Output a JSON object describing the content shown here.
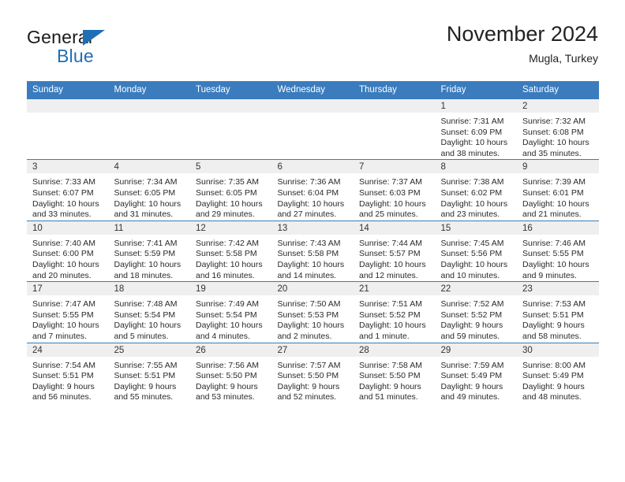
{
  "brand": {
    "name_part1": "General",
    "name_part2": "Blue",
    "logo_icon": "triangle-logo-icon",
    "accent_color": "#1f6fb5"
  },
  "header": {
    "title": "November 2024",
    "location": "Mugla, Turkey"
  },
  "theme": {
    "header_bar_color": "#3a7cbe",
    "daynum_strip_color": "#efefef",
    "row_border_color": "#3a7cbe",
    "text_color": "#2a2a2a"
  },
  "weekdays": [
    "Sunday",
    "Monday",
    "Tuesday",
    "Wednesday",
    "Thursday",
    "Friday",
    "Saturday"
  ],
  "weeks": [
    [
      {
        "day": "",
        "empty": true
      },
      {
        "day": "",
        "empty": true
      },
      {
        "day": "",
        "empty": true
      },
      {
        "day": "",
        "empty": true
      },
      {
        "day": "",
        "empty": true
      },
      {
        "day": "1",
        "sunrise": "Sunrise: 7:31 AM",
        "sunset": "Sunset: 6:09 PM",
        "daylight": "Daylight: 10 hours and 38 minutes."
      },
      {
        "day": "2",
        "sunrise": "Sunrise: 7:32 AM",
        "sunset": "Sunset: 6:08 PM",
        "daylight": "Daylight: 10 hours and 35 minutes."
      }
    ],
    [
      {
        "day": "3",
        "sunrise": "Sunrise: 7:33 AM",
        "sunset": "Sunset: 6:07 PM",
        "daylight": "Daylight: 10 hours and 33 minutes."
      },
      {
        "day": "4",
        "sunrise": "Sunrise: 7:34 AM",
        "sunset": "Sunset: 6:05 PM",
        "daylight": "Daylight: 10 hours and 31 minutes."
      },
      {
        "day": "5",
        "sunrise": "Sunrise: 7:35 AM",
        "sunset": "Sunset: 6:05 PM",
        "daylight": "Daylight: 10 hours and 29 minutes."
      },
      {
        "day": "6",
        "sunrise": "Sunrise: 7:36 AM",
        "sunset": "Sunset: 6:04 PM",
        "daylight": "Daylight: 10 hours and 27 minutes."
      },
      {
        "day": "7",
        "sunrise": "Sunrise: 7:37 AM",
        "sunset": "Sunset: 6:03 PM",
        "daylight": "Daylight: 10 hours and 25 minutes."
      },
      {
        "day": "8",
        "sunrise": "Sunrise: 7:38 AM",
        "sunset": "Sunset: 6:02 PM",
        "daylight": "Daylight: 10 hours and 23 minutes."
      },
      {
        "day": "9",
        "sunrise": "Sunrise: 7:39 AM",
        "sunset": "Sunset: 6:01 PM",
        "daylight": "Daylight: 10 hours and 21 minutes."
      }
    ],
    [
      {
        "day": "10",
        "sunrise": "Sunrise: 7:40 AM",
        "sunset": "Sunset: 6:00 PM",
        "daylight": "Daylight: 10 hours and 20 minutes."
      },
      {
        "day": "11",
        "sunrise": "Sunrise: 7:41 AM",
        "sunset": "Sunset: 5:59 PM",
        "daylight": "Daylight: 10 hours and 18 minutes."
      },
      {
        "day": "12",
        "sunrise": "Sunrise: 7:42 AM",
        "sunset": "Sunset: 5:58 PM",
        "daylight": "Daylight: 10 hours and 16 minutes."
      },
      {
        "day": "13",
        "sunrise": "Sunrise: 7:43 AM",
        "sunset": "Sunset: 5:58 PM",
        "daylight": "Daylight: 10 hours and 14 minutes."
      },
      {
        "day": "14",
        "sunrise": "Sunrise: 7:44 AM",
        "sunset": "Sunset: 5:57 PM",
        "daylight": "Daylight: 10 hours and 12 minutes."
      },
      {
        "day": "15",
        "sunrise": "Sunrise: 7:45 AM",
        "sunset": "Sunset: 5:56 PM",
        "daylight": "Daylight: 10 hours and 10 minutes."
      },
      {
        "day": "16",
        "sunrise": "Sunrise: 7:46 AM",
        "sunset": "Sunset: 5:55 PM",
        "daylight": "Daylight: 10 hours and 9 minutes."
      }
    ],
    [
      {
        "day": "17",
        "sunrise": "Sunrise: 7:47 AM",
        "sunset": "Sunset: 5:55 PM",
        "daylight": "Daylight: 10 hours and 7 minutes."
      },
      {
        "day": "18",
        "sunrise": "Sunrise: 7:48 AM",
        "sunset": "Sunset: 5:54 PM",
        "daylight": "Daylight: 10 hours and 5 minutes."
      },
      {
        "day": "19",
        "sunrise": "Sunrise: 7:49 AM",
        "sunset": "Sunset: 5:54 PM",
        "daylight": "Daylight: 10 hours and 4 minutes."
      },
      {
        "day": "20",
        "sunrise": "Sunrise: 7:50 AM",
        "sunset": "Sunset: 5:53 PM",
        "daylight": "Daylight: 10 hours and 2 minutes."
      },
      {
        "day": "21",
        "sunrise": "Sunrise: 7:51 AM",
        "sunset": "Sunset: 5:52 PM",
        "daylight": "Daylight: 10 hours and 1 minute."
      },
      {
        "day": "22",
        "sunrise": "Sunrise: 7:52 AM",
        "sunset": "Sunset: 5:52 PM",
        "daylight": "Daylight: 9 hours and 59 minutes."
      },
      {
        "day": "23",
        "sunrise": "Sunrise: 7:53 AM",
        "sunset": "Sunset: 5:51 PM",
        "daylight": "Daylight: 9 hours and 58 minutes."
      }
    ],
    [
      {
        "day": "24",
        "sunrise": "Sunrise: 7:54 AM",
        "sunset": "Sunset: 5:51 PM",
        "daylight": "Daylight: 9 hours and 56 minutes."
      },
      {
        "day": "25",
        "sunrise": "Sunrise: 7:55 AM",
        "sunset": "Sunset: 5:51 PM",
        "daylight": "Daylight: 9 hours and 55 minutes."
      },
      {
        "day": "26",
        "sunrise": "Sunrise: 7:56 AM",
        "sunset": "Sunset: 5:50 PM",
        "daylight": "Daylight: 9 hours and 53 minutes."
      },
      {
        "day": "27",
        "sunrise": "Sunrise: 7:57 AM",
        "sunset": "Sunset: 5:50 PM",
        "daylight": "Daylight: 9 hours and 52 minutes."
      },
      {
        "day": "28",
        "sunrise": "Sunrise: 7:58 AM",
        "sunset": "Sunset: 5:50 PM",
        "daylight": "Daylight: 9 hours and 51 minutes."
      },
      {
        "day": "29",
        "sunrise": "Sunrise: 7:59 AM",
        "sunset": "Sunset: 5:49 PM",
        "daylight": "Daylight: 9 hours and 49 minutes."
      },
      {
        "day": "30",
        "sunrise": "Sunrise: 8:00 AM",
        "sunset": "Sunset: 5:49 PM",
        "daylight": "Daylight: 9 hours and 48 minutes."
      }
    ]
  ]
}
